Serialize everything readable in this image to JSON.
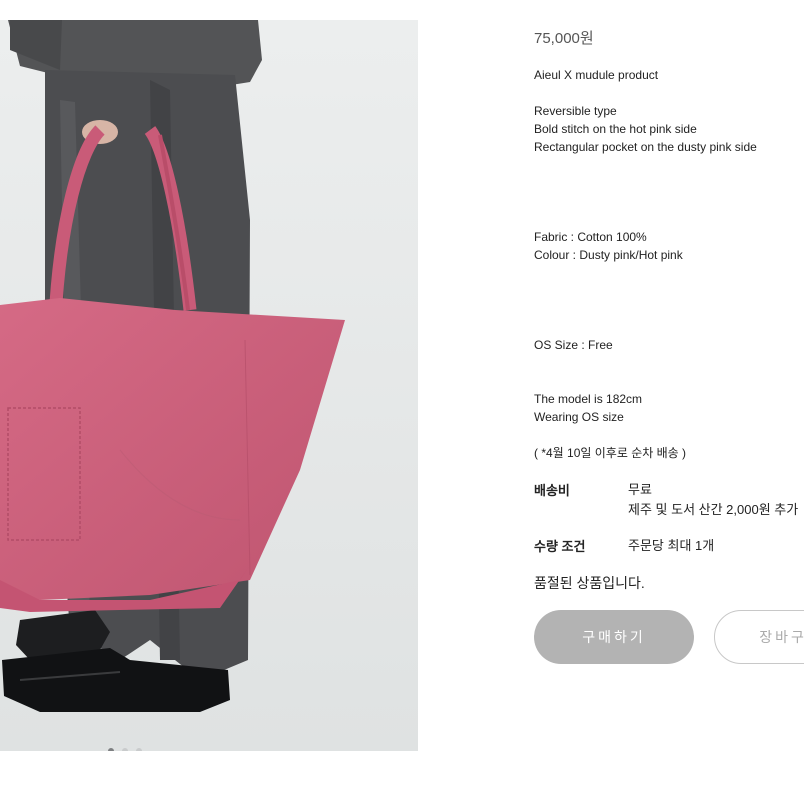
{
  "product": {
    "price": "75,000원",
    "collab": "Aieul X mudule product",
    "features": [
      "Reversible type",
      "Bold stitch on the hot pink side",
      "Rectangular pocket on the dusty pink side"
    ],
    "fabric": "Fabric : Cotton 100%",
    "colour": "Colour : Dusty pink/Hot pink",
    "size": "OS Size : Free",
    "model_height": "The model is 182cm",
    "model_size": "Wearing OS size",
    "shipping_note": "( *4월 10일 이후로 순차 배송 )"
  },
  "shipping": {
    "label": "배송비",
    "value": "무료",
    "extra": "제주 및 도서 산간 2,000원 추가"
  },
  "quantity": {
    "label": "수량 조건",
    "value": "주문당 최대 1개"
  },
  "status": "품절된 상품입니다.",
  "buttons": {
    "buy": "구매하기",
    "cart": "장바구니에"
  },
  "gallery": {
    "count": 3,
    "active_index": 0
  },
  "colors": {
    "bag": "#cc5f7b",
    "bag_inner": "#c1365f",
    "buy_button": "#b3b3b3"
  }
}
